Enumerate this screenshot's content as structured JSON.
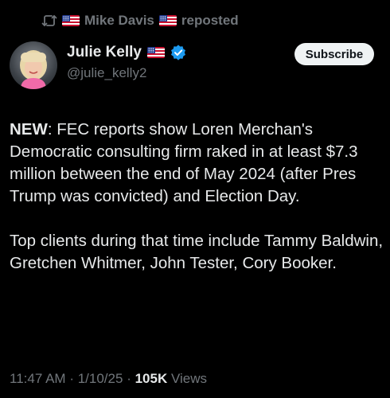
{
  "repost": {
    "reposter_name": "Mike Davis",
    "suffix": "reposted",
    "icon": "repost-icon"
  },
  "author": {
    "name": "Julie Kelly",
    "handle": "@julie_kelly2",
    "verified_icon": "verified-badge-icon",
    "flag_icon": "us-flag-emoji"
  },
  "subscribe_label": "Subscribe",
  "tweet": {
    "lead": "NEW",
    "para1_rest": ": FEC reports show Loren Merchan's Democratic consulting firm raked in at least $7.3 million between the end of May 2024 (after Pres Trump was convicted) and Election Day.",
    "para2": "Top clients during that time include Tammy Baldwin, Gretchen Whitmer, John Tester, Cory Booker."
  },
  "meta": {
    "time": "11:47 AM",
    "sep1": "·",
    "date": "1/10/25",
    "sep2": "·",
    "views_count": "105K",
    "views_label": "Views"
  },
  "colors": {
    "background": "#000000",
    "text_primary": "#e7e9ea",
    "text_secondary": "#71767b",
    "verified_blue": "#1d9bf0",
    "button_bg": "#eff3f4",
    "button_text": "#0f1419"
  }
}
